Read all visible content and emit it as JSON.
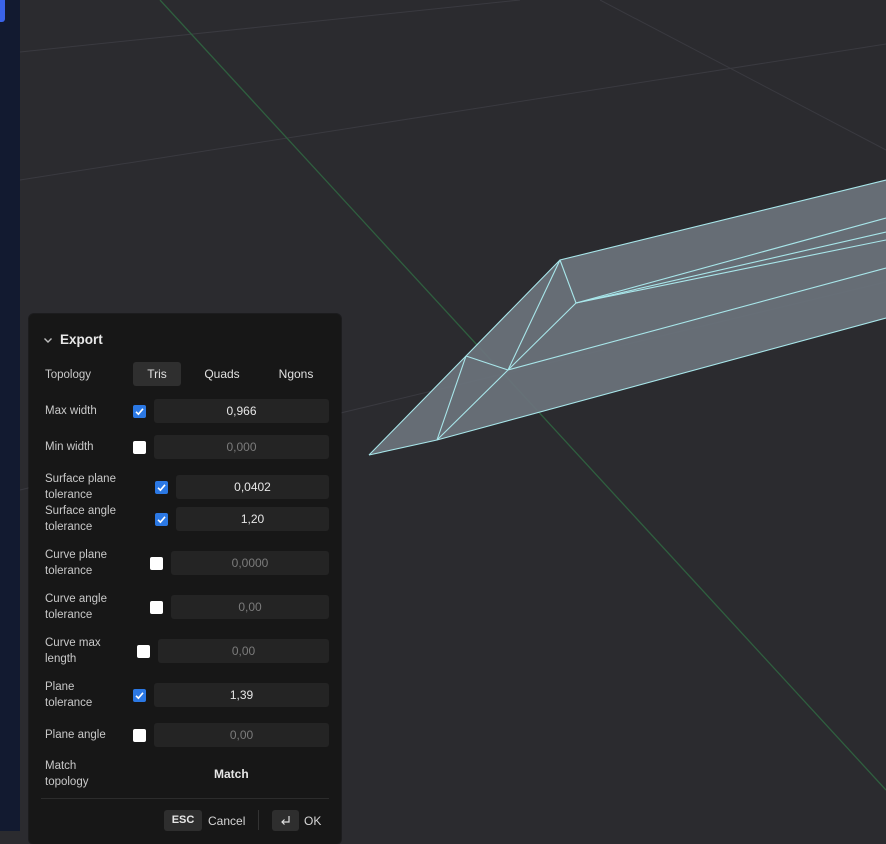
{
  "panel": {
    "title": "Export",
    "topology": {
      "label": "Topology",
      "options": [
        "Tris",
        "Quads",
        "Ngons"
      ],
      "selected": "Tris"
    },
    "rows": [
      {
        "label_lines": [
          "Max width"
        ],
        "checked": true,
        "value": "0,966"
      },
      {
        "label_lines": [
          "Min width"
        ],
        "checked": false,
        "value": "0,000"
      },
      {
        "label_lines": [
          "Surface plane",
          "tolerance"
        ],
        "checked": true,
        "value": "0,0402"
      },
      {
        "label_lines": [
          "Surface angle",
          "tolerance"
        ],
        "checked": true,
        "value": "1,20"
      },
      {
        "label_lines": [
          "Curve plane",
          "tolerance"
        ],
        "checked": false,
        "value": "0,0000"
      },
      {
        "label_lines": [
          "Curve angle",
          "tolerance"
        ],
        "checked": false,
        "value": "0,00"
      },
      {
        "label_lines": [
          "Curve max",
          "length"
        ],
        "checked": false,
        "value": "0,00"
      },
      {
        "label_lines": [
          "Plane",
          "tolerance"
        ],
        "checked": true,
        "value": "1,39"
      },
      {
        "label_lines": [
          "Plane angle"
        ],
        "checked": false,
        "value": "0,00"
      }
    ],
    "match_topology": {
      "label_lines": [
        "Match",
        "topology"
      ],
      "button": "Match"
    },
    "footer": {
      "cancel_key": "ESC",
      "cancel_label": "Cancel",
      "ok_key_icon": "enter-icon",
      "ok_label": "OK"
    }
  },
  "colors": {
    "background": "#2b2b2f",
    "panel": "#171717",
    "accent": "#2b78e4",
    "mesh_edge": "#a8e6ea",
    "mesh_fill": "#6b737c",
    "axis_green": "#2f5f3f"
  }
}
